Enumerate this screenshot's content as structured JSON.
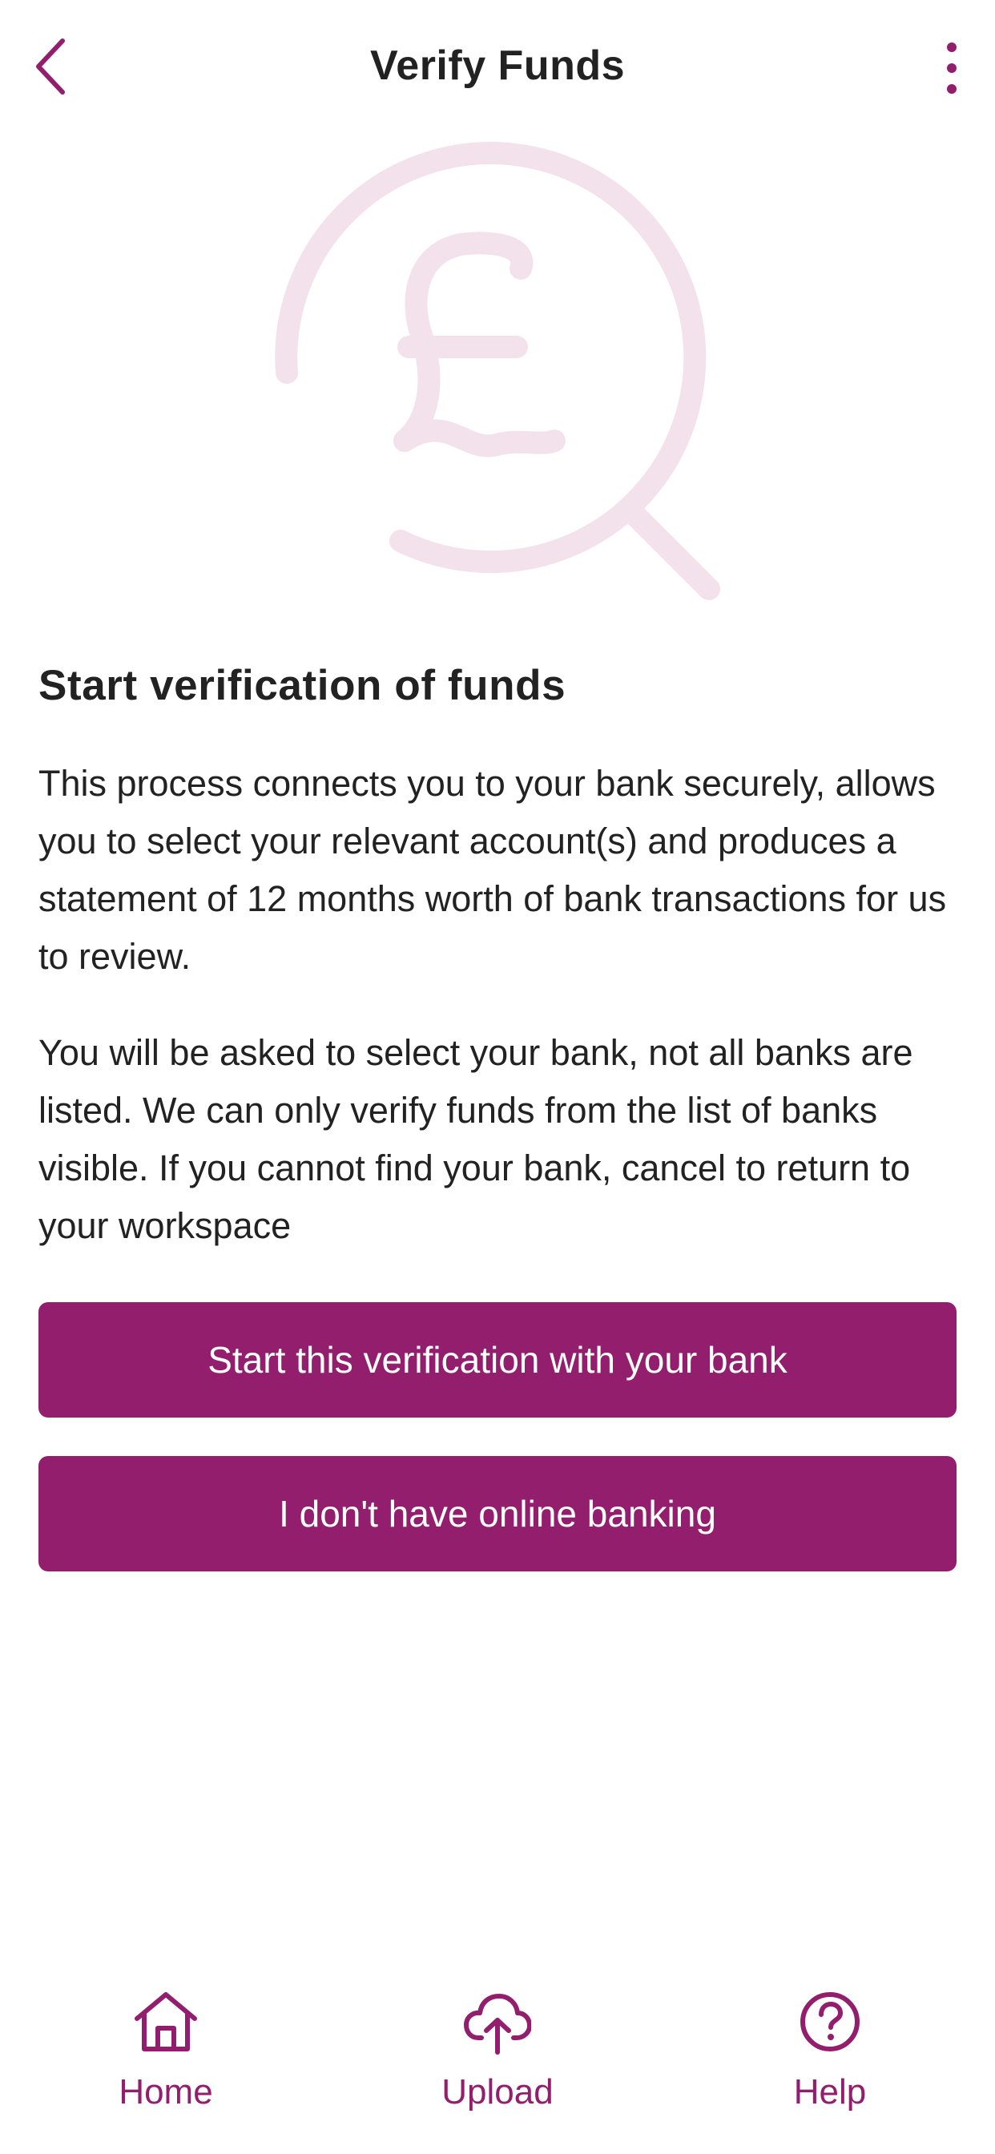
{
  "colors": {
    "accent": "#921e6d",
    "illustration": "#f3e1ec",
    "text": "#222222",
    "background": "#ffffff"
  },
  "header": {
    "title": "Verify Funds",
    "back_icon": "chevron-left-icon",
    "menu_icon": "more-vertical-icon"
  },
  "illustration": {
    "icon": "pound-magnifier-icon"
  },
  "content": {
    "heading": "Start verification of funds",
    "paragraph_1": "This process connects you to your bank securely, allows you to select your relevant account(s) and produces a statement of 12 months worth of bank transactions for us to review.",
    "paragraph_2": "You will be asked to select your bank, not all banks are listed. We can only verify funds from the list of banks visible. If you cannot find your bank, cancel to return to your workspace"
  },
  "buttons": {
    "start_label": "Start this verification with your bank",
    "no_online_label": "I don't have online banking"
  },
  "bottom_nav": {
    "items": [
      {
        "label": "Home",
        "icon": "home-icon"
      },
      {
        "label": "Upload",
        "icon": "cloud-upload-icon"
      },
      {
        "label": "Help",
        "icon": "help-circle-icon"
      }
    ]
  }
}
